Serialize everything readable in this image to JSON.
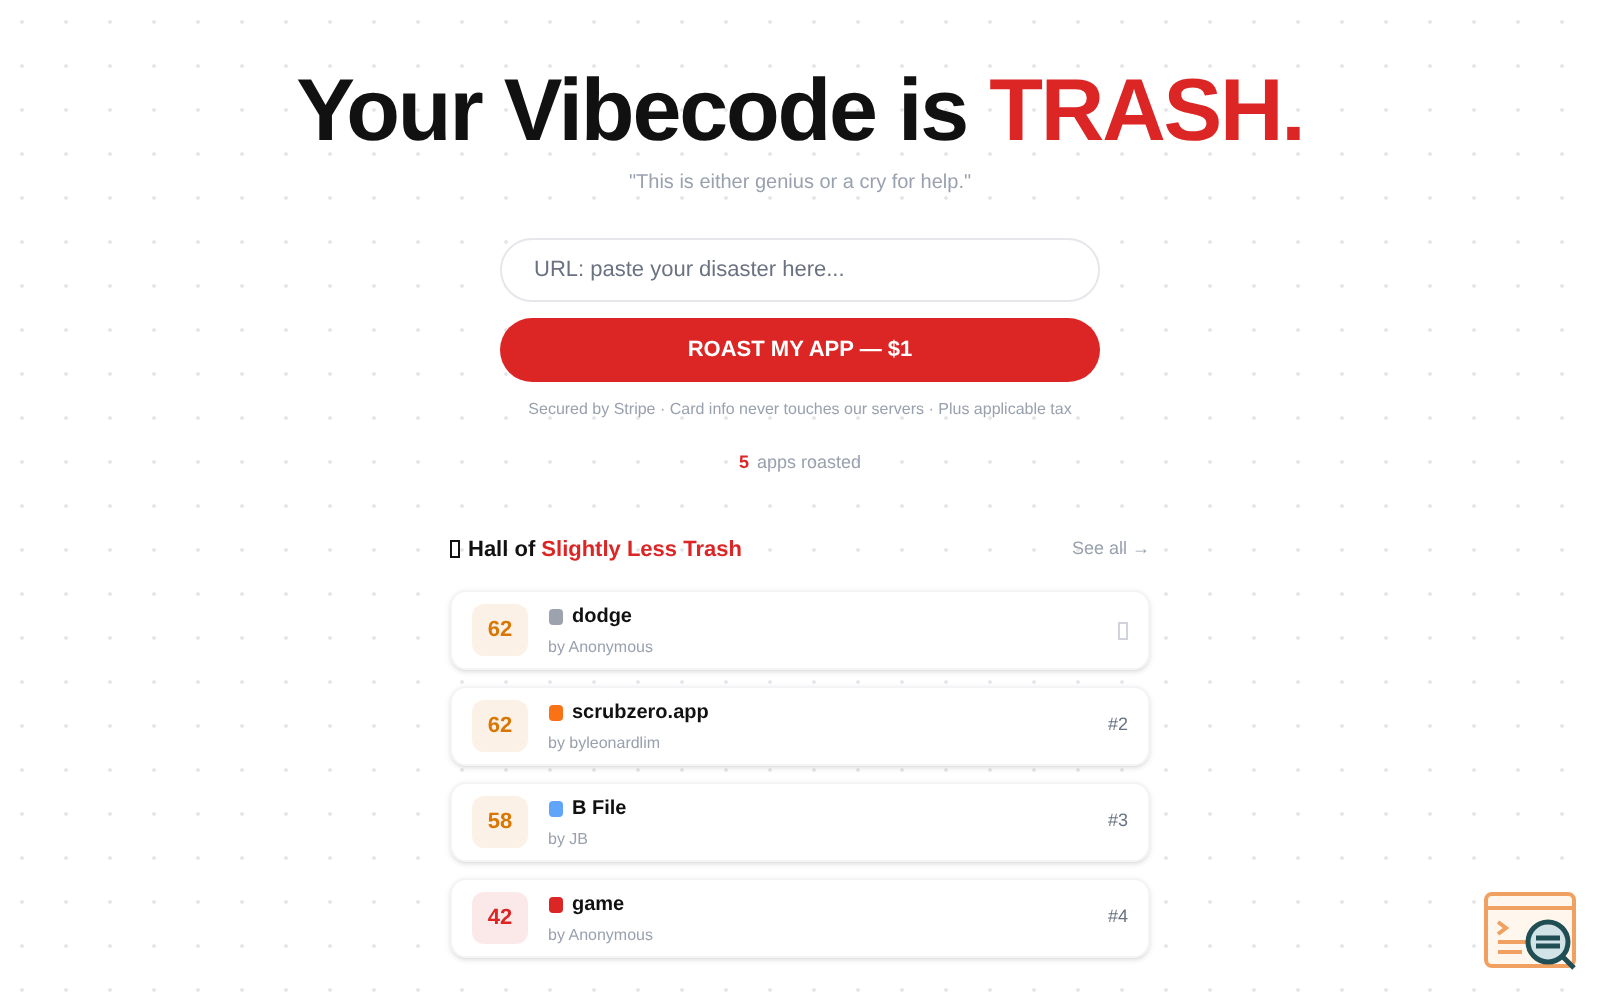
{
  "headline": {
    "text": "Your Vibecode is ",
    "accent": "TRASH."
  },
  "tagline": "\"This is either genius or a cry for help.\"",
  "url_field": {
    "placeholder": "URL: paste your disaster here..."
  },
  "submit_button": "ROAST MY APP — $1",
  "fine_print": "Secured by Stripe · Card info never touches our servers · Plus applicable tax",
  "counter": {
    "count": "5",
    "label": "apps roasted"
  },
  "hall": {
    "title": "Hall of ",
    "accent": "Slightly Less Trash",
    "see_all": "See all →",
    "rows": [
      {
        "score": "62",
        "color": "#d97706",
        "name": "dodge",
        "author": "by Anonymous"
      },
      {
        "score": "62",
        "color": "#d97706",
        "name": "scrubzero.app",
        "author": "by byleonardlim",
        "rank": "#2"
      },
      {
        "score": "58",
        "color": "#d97706",
        "name": "B File",
        "author": "by JB",
        "rank": "#3"
      },
      {
        "score": "42",
        "color": "#dc2626",
        "name": "game",
        "author": "by Anonymous",
        "rank": "#4"
      }
    ]
  }
}
